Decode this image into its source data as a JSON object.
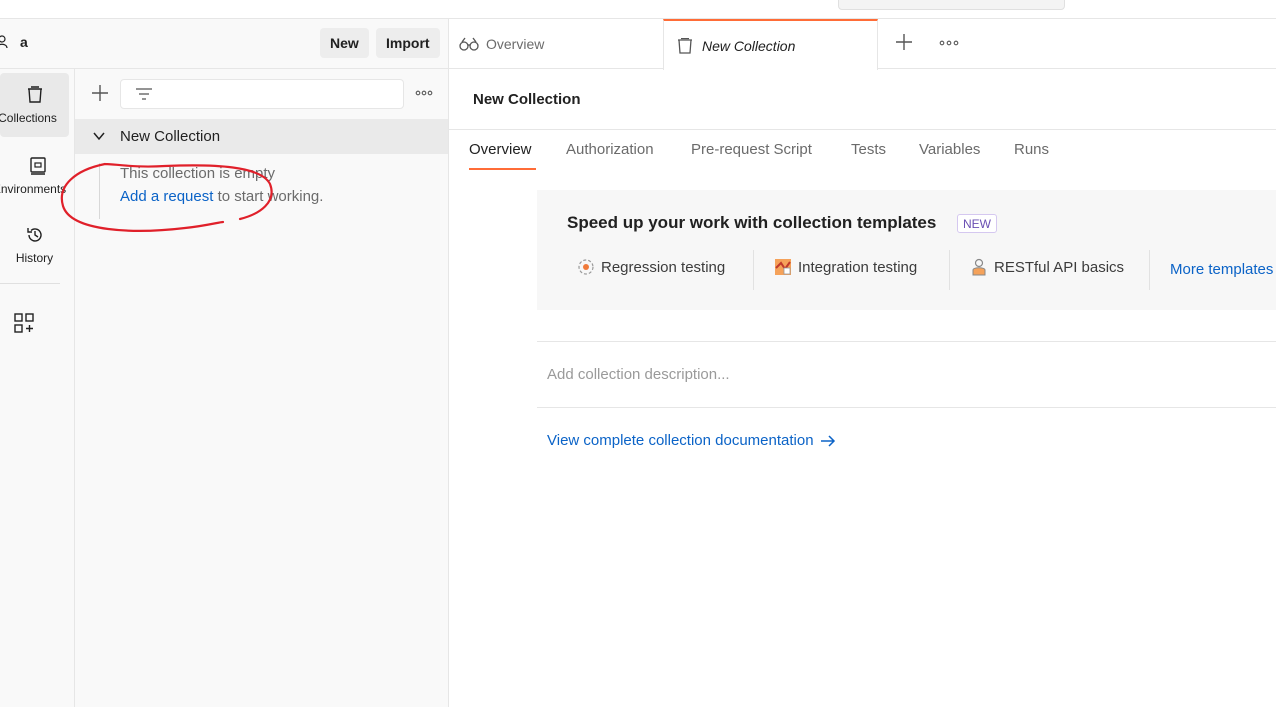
{
  "header": {
    "user_name": "a",
    "new_label": "New",
    "import_label": "Import"
  },
  "rail": {
    "collections": "Collections",
    "environments": "Environments",
    "history": "History"
  },
  "sidebar": {
    "collection_name": "New Collection",
    "empty_text": "This collection is empty",
    "add_request_link": "Add a request",
    "empty_suffix": " to start working."
  },
  "tabs": [
    {
      "label": "Overview",
      "icon": "overview-icon"
    },
    {
      "label": "New Collection",
      "icon": "collection-icon"
    }
  ],
  "main": {
    "title": "New Collection",
    "subtabs": [
      "Overview",
      "Authorization",
      "Pre-request Script",
      "Tests",
      "Variables",
      "Runs"
    ],
    "templates": {
      "title": "Speed up your work with collection templates",
      "badge": "NEW",
      "items": [
        "Regression testing",
        "Integration testing",
        "RESTful API basics"
      ],
      "more": "More templates"
    },
    "description_placeholder": "Add collection description...",
    "doc_link": "View complete collection documentation"
  },
  "colors": {
    "accent": "#ff6c37",
    "link": "#0b63c7",
    "annotation": "#e0202a"
  }
}
